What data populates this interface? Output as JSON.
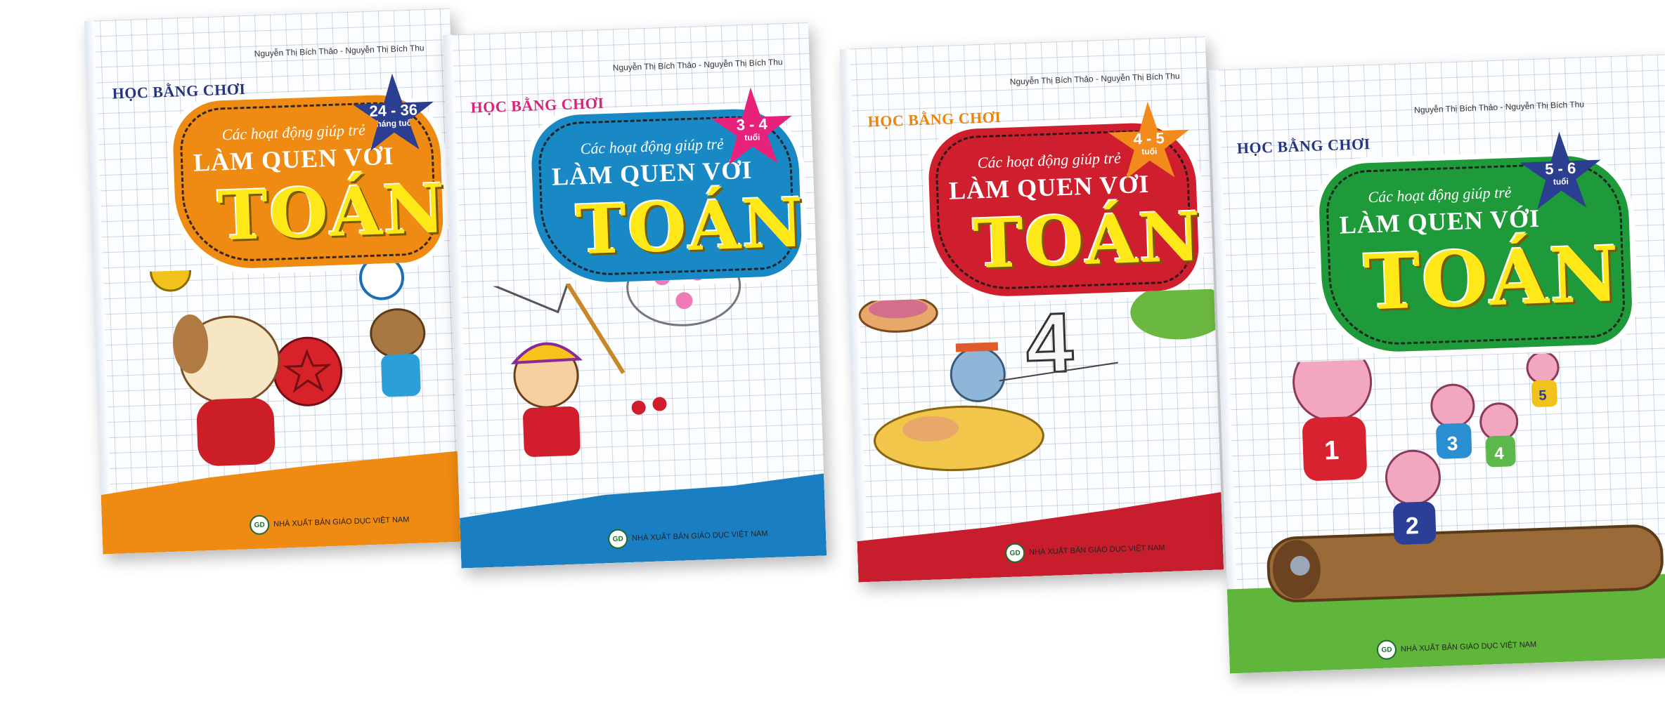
{
  "books": [
    {
      "series": "HỌC BẰNG CHƠI",
      "authors": "Nguyễn Thị Bích Thảo - Nguyễn Thị Bích Thu",
      "subtitle": "Các hoạt động giúp trẻ",
      "title_line1": "LÀM QUEN VỚI",
      "title_line2": "TOÁN",
      "age": "24 - 36",
      "age_unit": "tháng tuổi",
      "publisher": "NHÀ XUẤT BẢN GIÁO DỤC VIỆT NAM",
      "logo": "GD",
      "colors": {
        "badge": "#ef8a12",
        "star": "#2b3e8f",
        "ground": "#ef8a12",
        "series": "#27357e"
      }
    },
    {
      "series": "HỌC BẰNG CHƠI",
      "authors": "Nguyễn Thị Bích Thảo - Nguyễn Thị Bích Thu",
      "subtitle": "Các hoạt động giúp trẻ",
      "title_line1": "LÀM QUEN VỚI",
      "title_line2": "TOÁN",
      "age": "3 - 4",
      "age_unit": "tuổi",
      "publisher": "NHÀ XUẤT BẢN GIÁO DỤC VIỆT NAM",
      "logo": "GD",
      "colors": {
        "badge": "#1889c4",
        "star": "#e8217a",
        "ground": "#1a7fc2",
        "series": "#d8247a"
      }
    },
    {
      "series": "HỌC BẰNG CHƠI",
      "authors": "Nguyễn Thị Bích Thảo - Nguyễn Thị Bích Thu",
      "subtitle": "Các hoạt động giúp trẻ",
      "title_line1": "LÀM QUEN VỚI",
      "title_line2": "TOÁN",
      "age": "4 - 5",
      "age_unit": "tuổi",
      "publisher": "NHÀ XUẤT BẢN GIÁO DỤC VIỆT NAM",
      "logo": "GD",
      "colors": {
        "badge": "#cf1f2e",
        "star": "#f28a1c",
        "ground": "#c81d2c",
        "series": "#e8840f"
      }
    },
    {
      "series": "HỌC BẰNG CHƠI",
      "authors": "Nguyễn Thị Bích Thảo - Nguyễn Thị Bích Thu",
      "subtitle": "Các hoạt động giúp trẻ",
      "title_line1": "LÀM QUEN VỚI",
      "title_line2": "TOÁN",
      "age": "5 - 6",
      "age_unit": "tuổi",
      "publisher": "NHÀ XUẤT BẢN GIÁO DỤC VIỆT NAM",
      "logo": "GD",
      "colors": {
        "badge": "#1f9a3a",
        "star": "#2b3e8f",
        "ground": "#3aa83a",
        "series": "#27357e"
      }
    }
  ],
  "illustrations": {
    "book_3_number": "4",
    "book_4_numbers": [
      "1",
      "2",
      "3",
      "4",
      "5"
    ]
  }
}
